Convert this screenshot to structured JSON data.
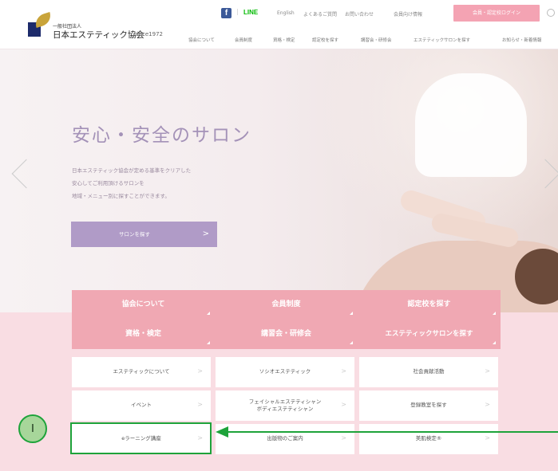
{
  "header": {
    "org_small": "一般社団法人",
    "org_name": "日本エステティック協会",
    "since": "since1972",
    "facebook_glyph": "f",
    "separator": "|",
    "line": "LINE",
    "util_links": [
      "English",
      "よくあるご質問",
      "お問い合わせ",
      "会員向け情報"
    ],
    "login": "会員・認定校ログイン",
    "nav": [
      "協会について",
      "会員制度",
      "資格・検定",
      "認定校を探す",
      "講習会・研修会",
      "エステティックサロンを探す",
      "お知らせ・新着情報"
    ]
  },
  "hero": {
    "title": "安心・安全のサロン",
    "desc": [
      "日本エステティック協会が定める基準をクリアした",
      "安心してご利用頂けるサロンを",
      "地域・メニュー別に探すことができます。"
    ],
    "button": "サロンを探す",
    "button_chevron": ">"
  },
  "categories": [
    "協会について",
    "会員制度",
    "認定校を探す",
    "資格・検定",
    "講習会・研修会",
    "エステティックサロンを探す"
  ],
  "sublinks": [
    [
      "エステティックについて",
      "ソシオエステティック",
      "社会貢献活動"
    ],
    [
      "イベント",
      "フェイシャルエステティシャン\nボディエステティシャン",
      "登録教室を探す"
    ],
    [
      "eラーニング講座",
      "出版物のご案内",
      "美肌検定®"
    ]
  ],
  "sub_chevron": ">",
  "annotation": {
    "badge": "I"
  }
}
